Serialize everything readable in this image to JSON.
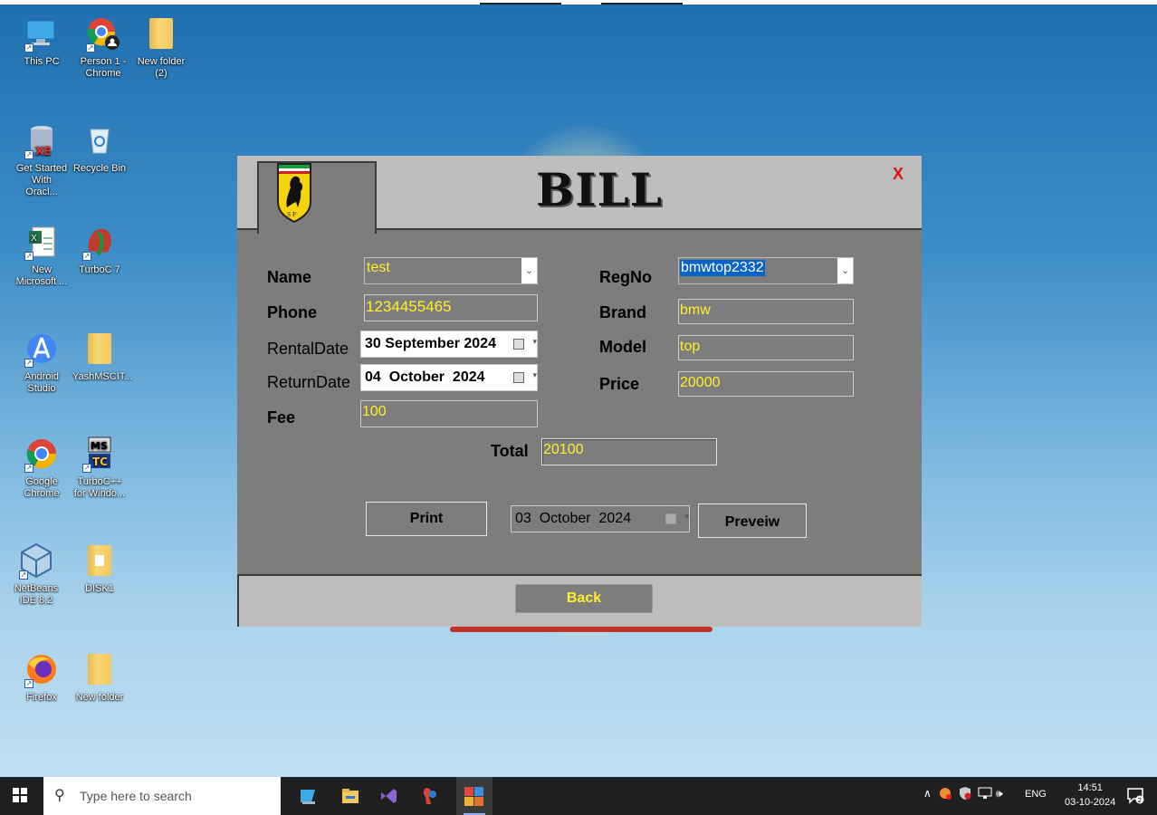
{
  "desktop": {
    "icons": [
      {
        "label": "This PC",
        "icon": "this-pc-icon"
      },
      {
        "label": "Person 1 - Chrome",
        "icon": "chrome-person-icon"
      },
      {
        "label": "New folder (2)",
        "icon": "folder-icon"
      },
      {
        "label": "Get Started With Oracl...",
        "icon": "oracle-xe-icon"
      },
      {
        "label": "Recycle Bin",
        "icon": "recycle-bin-icon"
      },
      {
        "label": "New Microsoft ...",
        "icon": "excel-file-icon"
      },
      {
        "label": "TurboC 7",
        "icon": "turboc-icon"
      },
      {
        "label": "Android Studio",
        "icon": "android-studio-icon"
      },
      {
        "label": "YashMSCIT...",
        "icon": "folder-icon"
      },
      {
        "label": "Google Chrome",
        "icon": "chrome-icon"
      },
      {
        "label": "TurboC++ for Windo...",
        "icon": "turbocpp-icon"
      },
      {
        "label": "NetBeans IDE 8.2",
        "icon": "netbeans-icon"
      },
      {
        "label": "DISK1",
        "icon": "folder-icon"
      },
      {
        "label": "Firefox",
        "icon": "firefox-icon"
      },
      {
        "label": "New folder",
        "icon": "folder-icon"
      }
    ]
  },
  "window": {
    "title": "BILL",
    "close_label": "X",
    "fields": {
      "name_label": "Name",
      "name_value": "test",
      "phone_label": "Phone",
      "phone_value": "1234455465",
      "rental_label": "RentalDate",
      "rental_value": "30 September 2024",
      "return_label": "ReturnDate",
      "return_value": "04  October  2024",
      "fee_label": "Fee",
      "fee_value": "100",
      "regno_label": "RegNo",
      "regno_value": "bmwtop2332",
      "brand_label": "Brand",
      "brand_value": "bmw",
      "model_label": "Model",
      "model_value": "top",
      "price_label": "Price",
      "price_value": "20000",
      "total_label": "Total",
      "total_value": "20100"
    },
    "print_label": "Print",
    "print_date": "03  October  2024",
    "preview_label": "Preveiw",
    "back_label": "Back"
  },
  "taskbar": {
    "search_placeholder": "Type here to search",
    "lang": "ENG",
    "time": "14:51",
    "date": "03-10-2024",
    "notification_count": "2"
  },
  "colors": {
    "accent_text": "#ffef2b",
    "window_bg": "#7d7d7d",
    "header_bg": "#bdbdbd",
    "close": "#e01010",
    "selection": "#0a63c9"
  }
}
